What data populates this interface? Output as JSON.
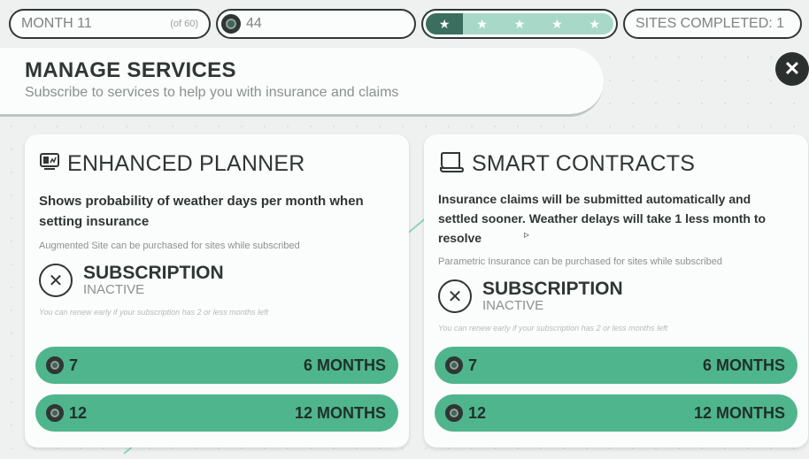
{
  "topbar": {
    "month_label": "MONTH 11",
    "month_of": "(of 60)",
    "coins": "44",
    "stars_filled": 1,
    "stars_total": 5,
    "sites_completed": "SITES COMPLETED: 1"
  },
  "header": {
    "title": "MANAGE SERVICES",
    "subtitle": "Subscribe to services to help you with insurance and claims"
  },
  "cards": [
    {
      "title": "ENHANCED PLANNER",
      "icon": "planner-icon",
      "description": "Shows probability of weather days per month when setting insurance",
      "note": "Augmented Site can be purchased for sites while subscribed",
      "status_title": "SUBSCRIPTION",
      "status": "INACTIVE",
      "renew_note": "You can renew early if your subscription has 2 or less months left",
      "options": [
        {
          "cost": "7",
          "duration": "6 MONTHS"
        },
        {
          "cost": "12",
          "duration": "12 MONTHS"
        }
      ]
    },
    {
      "title": "SMART CONTRACTS",
      "icon": "contract-icon",
      "description": "Insurance claims will be submitted automatically and settled sooner. Weather delays will take 1 less month to resolve",
      "note": "Parametric Insurance can be purchased for sites while subscribed",
      "status_title": "SUBSCRIPTION",
      "status": "INACTIVE",
      "renew_note": "You can renew early if your subscription has 2 or less months left",
      "options": [
        {
          "cost": "7",
          "duration": "6 MONTHS"
        },
        {
          "cost": "12",
          "duration": "12 MONTHS"
        }
      ]
    }
  ],
  "colors": {
    "accent": "#4fb58d",
    "dark": "#2f3634",
    "star_filled": "#3a6f5f",
    "star_empty": "#a8d9c8"
  }
}
